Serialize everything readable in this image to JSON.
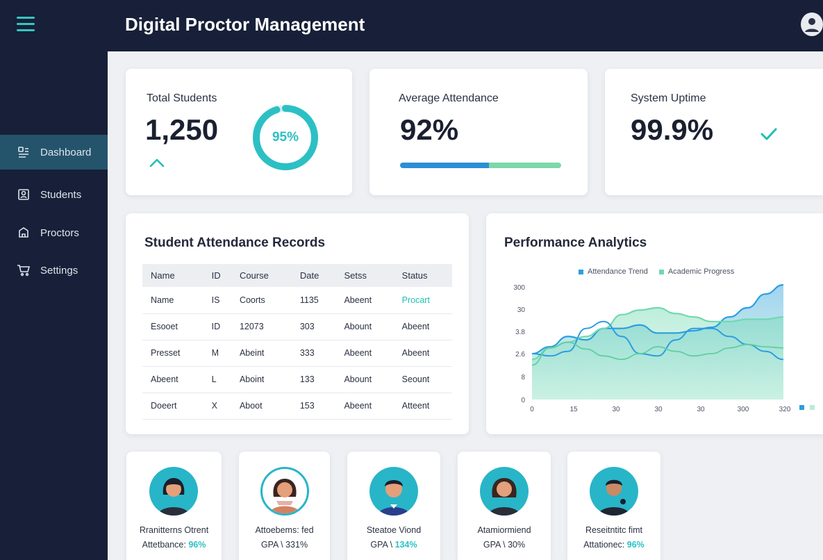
{
  "app": {
    "title": "Digital Proctor Management"
  },
  "sidebar": {
    "items": [
      {
        "label": "Dashboard",
        "icon": "dashboard-icon",
        "active": true
      },
      {
        "label": "Students",
        "icon": "students-icon",
        "active": false
      },
      {
        "label": "Proctors",
        "icon": "proctors-icon",
        "active": false
      },
      {
        "label": "Settings",
        "icon": "settings-icon",
        "active": false
      }
    ]
  },
  "stats": {
    "total_students": {
      "label": "Total Students",
      "value": "1,250",
      "ring_label": "95%",
      "ring_fraction": 0.95,
      "trend_icon": "chevron-up-icon"
    },
    "average_attendance": {
      "label": "Average Attendance",
      "value": "92%",
      "progress_fraction": 0.55
    },
    "system_uptime": {
      "label": "System Uptime",
      "value": "99.9%",
      "status_icon": "checkmark-icon"
    }
  },
  "attendance": {
    "title": "Student Attendance Records",
    "columns": [
      "Name",
      "ID",
      "Course",
      "Date",
      "Setss",
      "Status"
    ],
    "rows": [
      [
        "Name",
        "IS",
        "Coorts",
        "1135",
        "Abeent",
        "Procart"
      ],
      [
        "Esooet",
        "ID",
        "12073",
        "303",
        "Abount",
        "Abeent"
      ],
      [
        "Presset",
        "M",
        "Abeint",
        "333",
        "Abeent",
        "Abeent"
      ],
      [
        "Abeent",
        "L",
        "Aboint",
        "133",
        "Abount",
        "Seount"
      ],
      [
        "Doeert",
        "X",
        "Aboot",
        "153",
        "Abeent",
        "Atteent"
      ]
    ]
  },
  "analytics": {
    "title": "Performance Analytics",
    "legend": [
      {
        "name": "Attendance Trend",
        "color": "#2b9ee0"
      },
      {
        "name": "Academic Progress",
        "color": "#6fd9b0"
      }
    ],
    "y_ticks": [
      "300",
      "30",
      "3.8",
      "2.6",
      "8",
      "0"
    ],
    "x_ticks": [
      "0",
      "15",
      "30",
      "30",
      "30",
      "300",
      "320"
    ]
  },
  "chart_data": {
    "type": "area",
    "title": "Performance Analytics",
    "series": [
      {
        "name": "Attendance Trend",
        "color": "#2b9ee0",
        "values": [
          0.4,
          0.46,
          0.55,
          0.52,
          0.62,
          0.62,
          0.65,
          0.58,
          0.58,
          0.6,
          0.63,
          0.72,
          0.8,
          0.92,
          1.0
        ]
      },
      {
        "name": "Academic Progress",
        "color": "#6fd9b0",
        "values": [
          0.35,
          0.45,
          0.5,
          0.55,
          0.62,
          0.74,
          0.78,
          0.8,
          0.75,
          0.72,
          0.68,
          0.68,
          0.7,
          0.7,
          0.72
        ]
      },
      {
        "name": "",
        "color": "#2b9ee0",
        "values": [
          0.4,
          0.38,
          0.42,
          0.62,
          0.68,
          0.55,
          0.4,
          0.38,
          0.52,
          0.62,
          0.62,
          0.55,
          0.48,
          0.42,
          0.35
        ]
      },
      {
        "name": "",
        "color": "#5fcfa0",
        "values": [
          0.3,
          0.45,
          0.5,
          0.44,
          0.38,
          0.35,
          0.4,
          0.46,
          0.42,
          0.38,
          0.4,
          0.45,
          0.48,
          0.46,
          0.45
        ]
      }
    ]
  },
  "profiles": [
    {
      "name": "Rranitterns Otrent",
      "stat_label": "Attetbance:",
      "stat_value": "96%",
      "stat_highlight": true,
      "avatar": "student-avatar-icon"
    },
    {
      "name": "Attoebems: fed",
      "stat_label": "GPA \\",
      "stat_value": "331%",
      "stat_highlight": false,
      "avatar": "student-avatar-icon"
    },
    {
      "name": "Steatoe Viond",
      "stat_label": "GPA \\",
      "stat_value": "134%",
      "stat_highlight": true,
      "avatar": "student-avatar-icon"
    },
    {
      "name": "Atamiormiend",
      "stat_label": "GPA \\",
      "stat_value": "30%",
      "stat_highlight": false,
      "avatar": "student-avatar-icon"
    },
    {
      "name": "Reseitntitc fimt",
      "stat_label": "Attationec:",
      "stat_value": "96%",
      "stat_highlight": true,
      "avatar": "student-avatar-icon"
    }
  ]
}
